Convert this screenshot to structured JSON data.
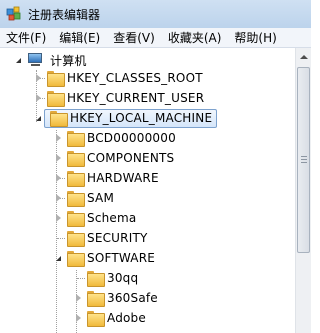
{
  "window": {
    "title": "注册表编辑器"
  },
  "menu": [
    "文件(F)",
    "编辑(E)",
    "查看(V)",
    "收藏夹(A)",
    "帮助(H)"
  ],
  "tree": {
    "root": "计算机",
    "hives": [
      "HKEY_CLASSES_ROOT",
      "HKEY_CURRENT_USER",
      "HKEY_LOCAL_MACHINE"
    ],
    "local_machine_children": [
      "BCD00000000",
      "COMPONENTS",
      "HARDWARE",
      "SAM",
      "Schema",
      "SECURITY",
      "SOFTWARE"
    ],
    "software_children": [
      "30qq",
      "360Safe",
      "Adobe"
    ],
    "selected": "HKEY_LOCAL_MACHINE"
  },
  "icons": {
    "app": "registry-editor-icon",
    "computer": "computer-icon",
    "folder": "folder-icon"
  }
}
